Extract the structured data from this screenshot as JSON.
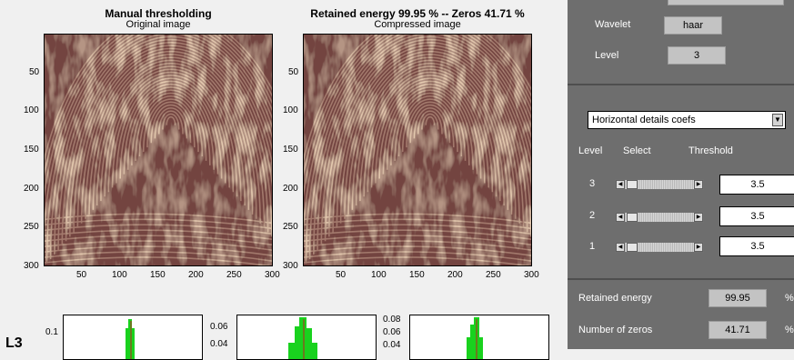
{
  "images": {
    "left": {
      "title": "Manual thresholding",
      "subtitle": "Original image"
    },
    "right": {
      "title": "Retained energy 99.95 % -- Zeros 41.71 %",
      "subtitle": "Compressed image"
    },
    "yticks": [
      "50",
      "100",
      "150",
      "200",
      "250",
      "300"
    ],
    "xticks": [
      "50",
      "100",
      "150",
      "200",
      "250",
      "300"
    ]
  },
  "histograms": {
    "row_label": "L3",
    "h1_yticks": [
      "0.1"
    ],
    "h2_yticks": [
      "0.06",
      "0.04"
    ],
    "h3_yticks": [
      "0.08",
      "0.06",
      "0.04"
    ]
  },
  "panel": {
    "wavelet_label": "Wavelet",
    "wavelet_value": "haar",
    "level_label": "Level",
    "level_value": "3",
    "dropdown_value": "Horizontal details coefs",
    "col_level": "Level",
    "col_select": "Select",
    "col_threshold": "Threshold",
    "rows": [
      {
        "level": "3",
        "threshold": "3.5"
      },
      {
        "level": "2",
        "threshold": "3.5"
      },
      {
        "level": "1",
        "threshold": "3.5"
      }
    ],
    "retained_label": "Retained energy",
    "retained_value": "99.95",
    "zeros_label": "Number of zeros",
    "zeros_value": "41.71",
    "percent": "%"
  },
  "colors": {
    "panel_bg": "#6e6e6e",
    "hist_green": "#19d21e",
    "fingerprint_dark": "#5a3230",
    "fingerprint_light": "#e6c8aa"
  }
}
